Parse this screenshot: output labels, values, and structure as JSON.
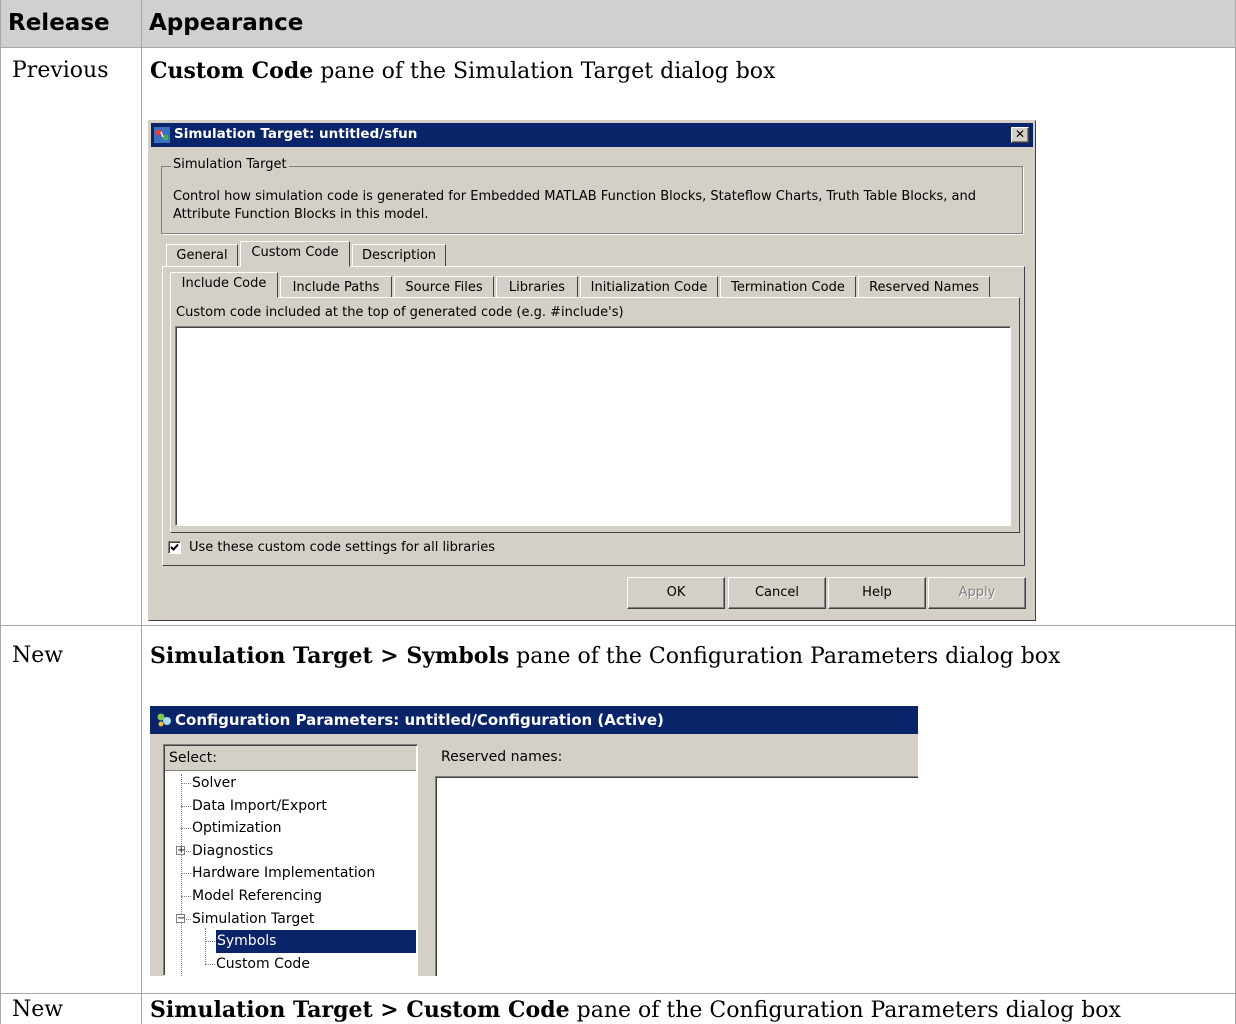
{
  "table": {
    "headers": {
      "release": "Release",
      "appearance": "Appearance"
    },
    "rows": [
      {
        "release": "Previous",
        "bold": "Custom Code",
        "rest": " pane of the Simulation Target dialog box"
      },
      {
        "release": "New",
        "bold": "Simulation Target > Symbols",
        "rest": " pane of the Configuration Parameters dialog box"
      },
      {
        "release": "New",
        "bold": "Simulation Target > Custom Code",
        "rest": " pane of the Configuration Parameters dialog box"
      }
    ]
  },
  "dialog1": {
    "title": "Simulation Target: untitled/sfun",
    "close_glyph": "✕",
    "group_label": "Simulation Target",
    "description": "Control how simulation code is generated for Embedded MATLAB Function Blocks, Stateflow Charts, Truth Table Blocks, and Attribute Function Blocks in this model.",
    "tabs": [
      "General",
      "Custom Code",
      "Description"
    ],
    "active_tab": "Custom Code",
    "subtabs": [
      "Include Code",
      "Include Paths",
      "Source Files",
      "Libraries",
      "Initialization Code",
      "Termination Code",
      "Reserved Names"
    ],
    "active_subtab": "Include Code",
    "field_label": "Custom code included at the top of generated code (e.g. #include's)",
    "field_value": "",
    "checkbox_label": "Use these custom code settings for all libraries",
    "checkbox_checked": true,
    "buttons": {
      "ok": "OK",
      "cancel": "Cancel",
      "help": "Help",
      "apply": "Apply"
    }
  },
  "dialog2": {
    "title": "Configuration Parameters: untitled/Configuration (Active)",
    "select_label": "Select:",
    "tree": [
      {
        "label": "Solver",
        "level": 0,
        "expander": ""
      },
      {
        "label": "Data Import/Export",
        "level": 0,
        "expander": ""
      },
      {
        "label": "Optimization",
        "level": 0,
        "expander": ""
      },
      {
        "label": "Diagnostics",
        "level": 0,
        "expander": "+"
      },
      {
        "label": "Hardware Implementation",
        "level": 0,
        "expander": ""
      },
      {
        "label": "Model Referencing",
        "level": 0,
        "expander": ""
      },
      {
        "label": "Simulation Target",
        "level": 0,
        "expander": "−"
      },
      {
        "label": "Symbols",
        "level": 1,
        "expander": "",
        "selected": true
      },
      {
        "label": "Custom Code",
        "level": 1,
        "expander": ""
      }
    ],
    "reserved_label": "Reserved names:",
    "reserved_value": ""
  }
}
